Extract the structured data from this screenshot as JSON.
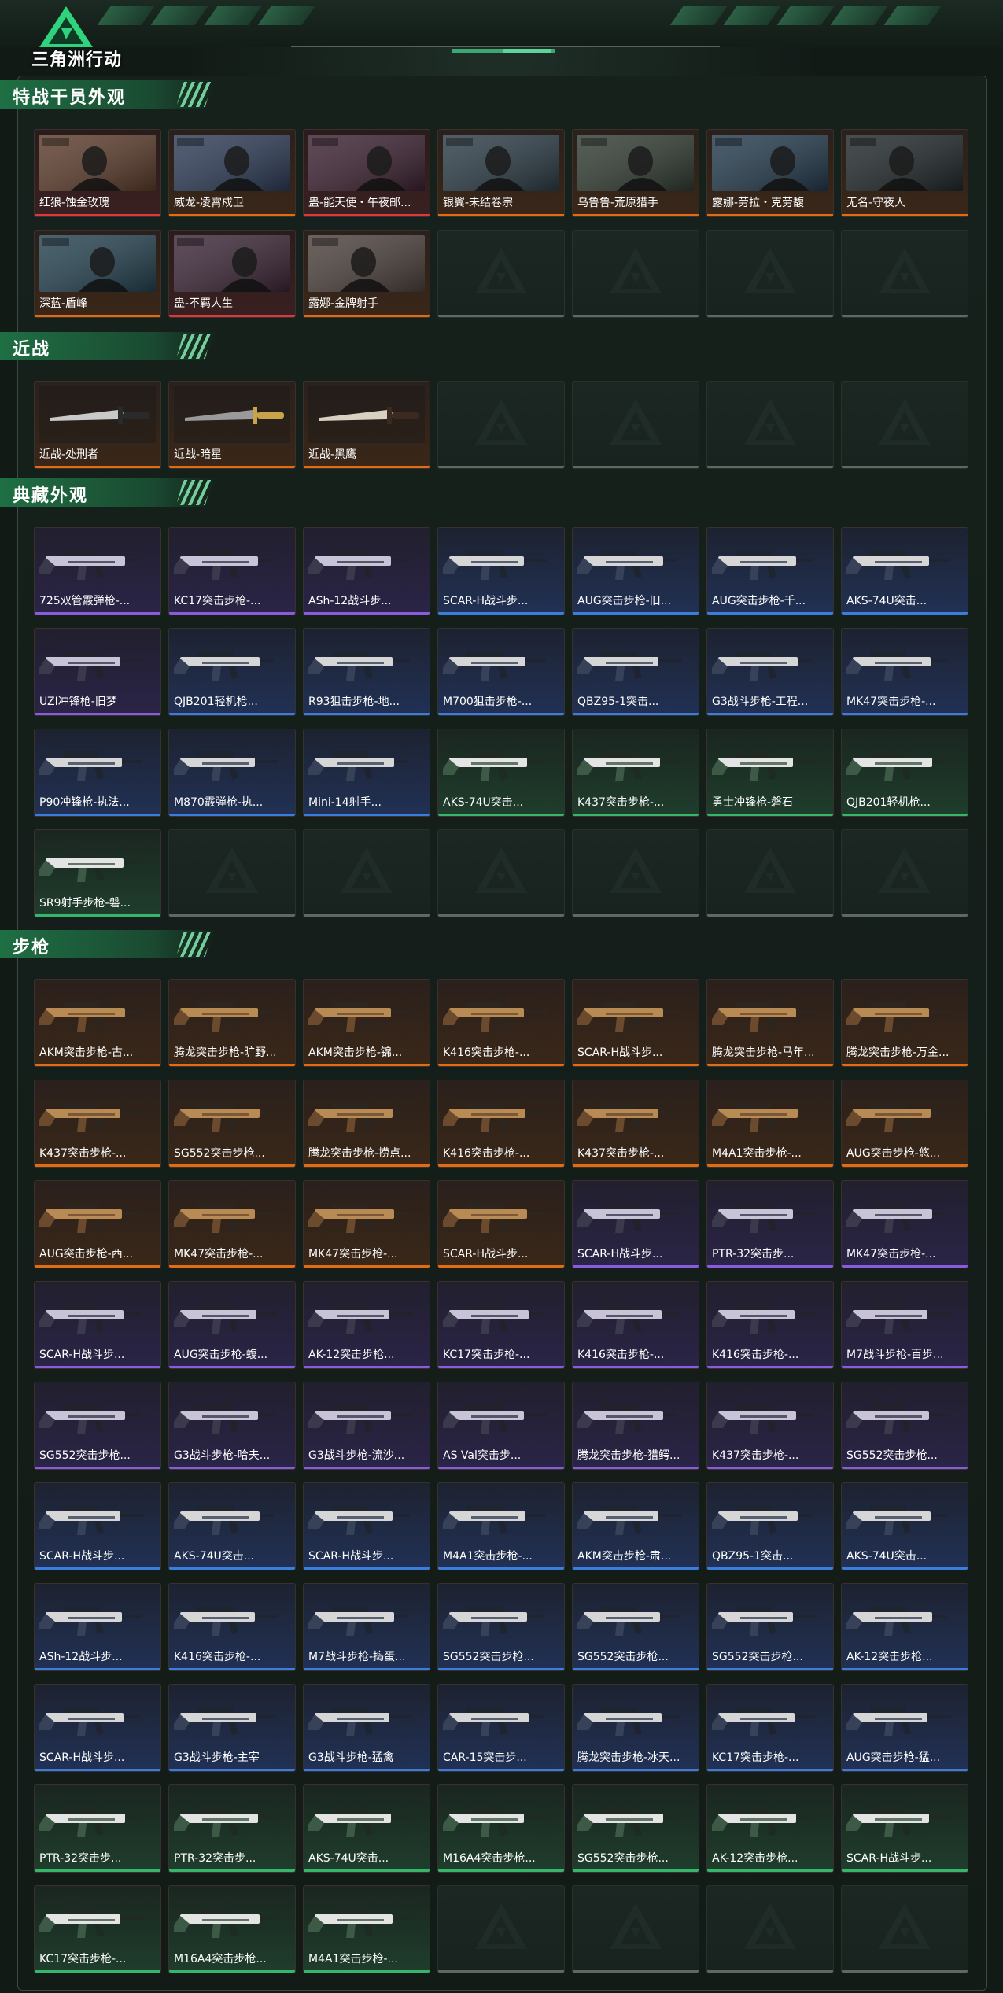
{
  "header": {
    "game_title": "三角洲行动",
    "logo_icon": "delta-logo-icon"
  },
  "colors": {
    "accent_green": "#36b66a",
    "rarity_orange": "#e06d16",
    "rarity_purple": "#8a5bdc",
    "rarity_blue": "#3b7ddc",
    "rarity_green": "#36b66a",
    "rarity_red": "#d93b3b"
  },
  "sections": [
    {
      "title": "特战干员外观",
      "kind": "operator",
      "items": [
        {
          "name": "红狼-蚀金玫瑰",
          "rarity": "red",
          "tag": "蚀金玫瑰"
        },
        {
          "name": "威龙-凌霄戍卫",
          "rarity": "orange",
          "tag": "凌霄戍卫"
        },
        {
          "name": "蛊-能天使・午夜邮差",
          "display": "蛊-能天使・午夜邮...",
          "rarity": "red",
          "tag": "午夜邮差"
        },
        {
          "name": "银翼-未结卷宗",
          "rarity": "orange",
          "tag": "未结卷宗"
        },
        {
          "name": "乌鲁鲁-荒原猎手",
          "rarity": "orange",
          "tag": ""
        },
        {
          "name": "露娜-劳拉・克劳馥",
          "rarity": "orange",
          "tag": "劳拉"
        },
        {
          "name": "无名-守夜人",
          "rarity": "orange",
          "tag": "守夜人"
        },
        {
          "name": "深蓝-盾峰",
          "rarity": "orange",
          "tag": "盾峰"
        },
        {
          "name": "蛊-不羁人生",
          "rarity": "red",
          "tag": "不羁人生"
        },
        {
          "name": "露娜-金牌射手",
          "rarity": "orange",
          "tag": ""
        }
      ],
      "slots": 14
    },
    {
      "title": "近战",
      "kind": "melee",
      "items": [
        {
          "name": "近战-处刑者",
          "rarity": "orange"
        },
        {
          "name": "近战-暗星",
          "rarity": "orange"
        },
        {
          "name": "近战-黑鹰",
          "rarity": "orange"
        }
      ],
      "slots": 7
    },
    {
      "title": "典藏外观",
      "kind": "weapon",
      "items": [
        {
          "name": "725双管霰弹枪-...",
          "rarity": "purple"
        },
        {
          "name": "KC17突击步枪-...",
          "rarity": "purple"
        },
        {
          "name": "ASh-12战斗步...",
          "rarity": "purple"
        },
        {
          "name": "SCAR-H战斗步...",
          "rarity": "blue"
        },
        {
          "name": "AUG突击步枪-旧...",
          "rarity": "blue"
        },
        {
          "name": "AUG突击步枪-千...",
          "rarity": "blue"
        },
        {
          "name": "AKS-74U突击...",
          "rarity": "blue"
        },
        {
          "name": "UZI冲锋枪-旧梦",
          "rarity": "purple"
        },
        {
          "name": "QJB201轻机枪...",
          "rarity": "blue"
        },
        {
          "name": "R93狙击步枪-地...",
          "rarity": "blue"
        },
        {
          "name": "M700狙击步枪-...",
          "rarity": "blue"
        },
        {
          "name": "QBZ95-1突击...",
          "rarity": "blue"
        },
        {
          "name": "G3战斗步枪-工程...",
          "rarity": "blue"
        },
        {
          "name": "MK47突击步枪-...",
          "rarity": "blue"
        },
        {
          "name": "P90冲锋枪-执法...",
          "rarity": "blue"
        },
        {
          "name": "M870霰弹枪-执...",
          "rarity": "blue"
        },
        {
          "name": "Mini-14射手...",
          "rarity": "blue"
        },
        {
          "name": "AKS-74U突击...",
          "rarity": "green"
        },
        {
          "name": "K437突击步枪-...",
          "rarity": "green"
        },
        {
          "name": "勇士冲锋枪-磐石",
          "rarity": "green"
        },
        {
          "name": "QJB201轻机枪...",
          "rarity": "green"
        },
        {
          "name": "SR9射手步枪-磐...",
          "rarity": "green"
        }
      ],
      "slots": 28
    },
    {
      "title": "步枪",
      "kind": "weapon",
      "items": [
        {
          "name": "AKM突击步枪-古...",
          "rarity": "orange"
        },
        {
          "name": "腾龙突击步枪-旷野...",
          "rarity": "orange"
        },
        {
          "name": "AKM突击步枪-锦...",
          "rarity": "orange"
        },
        {
          "name": "K416突击步枪-...",
          "rarity": "orange"
        },
        {
          "name": "SCAR-H战斗步...",
          "rarity": "orange"
        },
        {
          "name": "腾龙突击步枪-马年...",
          "rarity": "orange"
        },
        {
          "name": "腾龙突击步枪-万金...",
          "rarity": "orange"
        },
        {
          "name": "K437突击步枪-...",
          "rarity": "orange"
        },
        {
          "name": "SG552突击步枪...",
          "rarity": "orange"
        },
        {
          "name": "腾龙突击步枪-捞点...",
          "rarity": "orange"
        },
        {
          "name": "K416突击步枪-...",
          "rarity": "orange"
        },
        {
          "name": "K437突击步枪-...",
          "rarity": "orange"
        },
        {
          "name": "M4A1突击步枪-...",
          "rarity": "orange"
        },
        {
          "name": "AUG突击步枪-悠...",
          "rarity": "orange"
        },
        {
          "name": "AUG突击步枪-西...",
          "rarity": "orange"
        },
        {
          "name": "MK47突击步枪-...",
          "rarity": "orange"
        },
        {
          "name": "MK47突击步枪-...",
          "rarity": "orange"
        },
        {
          "name": "SCAR-H战斗步...",
          "rarity": "orange"
        },
        {
          "name": "SCAR-H战斗步...",
          "rarity": "purple"
        },
        {
          "name": "PTR-32突击步...",
          "rarity": "purple"
        },
        {
          "name": "MK47突击步枪-...",
          "rarity": "purple"
        },
        {
          "name": "SCAR-H战斗步...",
          "rarity": "purple"
        },
        {
          "name": "AUG突击步枪-蝮...",
          "rarity": "purple"
        },
        {
          "name": "AK-12突击步枪...",
          "rarity": "purple"
        },
        {
          "name": "KC17突击步枪-...",
          "rarity": "purple"
        },
        {
          "name": "K416突击步枪-...",
          "rarity": "purple"
        },
        {
          "name": "K416突击步枪-...",
          "rarity": "purple"
        },
        {
          "name": "M7战斗步枪-百步...",
          "rarity": "purple"
        },
        {
          "name": "SG552突击步枪...",
          "rarity": "purple"
        },
        {
          "name": "G3战斗步枪-哈夫...",
          "rarity": "purple"
        },
        {
          "name": "G3战斗步枪-流沙...",
          "rarity": "purple"
        },
        {
          "name": "AS Val突击步...",
          "rarity": "purple"
        },
        {
          "name": "腾龙突击步枪-猎鳄...",
          "rarity": "purple"
        },
        {
          "name": "K437突击步枪-...",
          "rarity": "purple"
        },
        {
          "name": "SG552突击步枪...",
          "rarity": "purple"
        },
        {
          "name": "SCAR-H战斗步...",
          "rarity": "blue"
        },
        {
          "name": "AKS-74U突击...",
          "rarity": "blue"
        },
        {
          "name": "SCAR-H战斗步...",
          "rarity": "blue"
        },
        {
          "name": "M4A1突击步枪-...",
          "rarity": "blue"
        },
        {
          "name": "AKM突击步枪-肃...",
          "rarity": "blue"
        },
        {
          "name": "QBZ95-1突击...",
          "rarity": "blue"
        },
        {
          "name": "AKS-74U突击...",
          "rarity": "blue"
        },
        {
          "name": "ASh-12战斗步...",
          "rarity": "blue"
        },
        {
          "name": "K416突击步枪-...",
          "rarity": "blue"
        },
        {
          "name": "M7战斗步枪-捣蛋...",
          "rarity": "blue"
        },
        {
          "name": "SG552突击步枪...",
          "rarity": "blue"
        },
        {
          "name": "SG552突击步枪...",
          "rarity": "blue"
        },
        {
          "name": "SG552突击步枪...",
          "rarity": "blue"
        },
        {
          "name": "AK-12突击步枪...",
          "rarity": "blue"
        },
        {
          "name": "SCAR-H战斗步...",
          "rarity": "blue"
        },
        {
          "name": "G3战斗步枪-主宰",
          "rarity": "blue"
        },
        {
          "name": "G3战斗步枪-猛禽",
          "rarity": "blue"
        },
        {
          "name": "CAR-15突击步...",
          "rarity": "blue"
        },
        {
          "name": "腾龙突击步枪-冰天...",
          "rarity": "blue"
        },
        {
          "name": "KC17突击步枪-...",
          "rarity": "blue"
        },
        {
          "name": "AUG突击步枪-猛...",
          "rarity": "blue"
        },
        {
          "name": "PTR-32突击步...",
          "rarity": "green"
        },
        {
          "name": "PTR-32突击步...",
          "rarity": "green"
        },
        {
          "name": "AKS-74U突击...",
          "rarity": "green"
        },
        {
          "name": "M16A4突击步枪...",
          "rarity": "green"
        },
        {
          "name": "SG552突击步枪...",
          "rarity": "green"
        },
        {
          "name": "AK-12突击步枪...",
          "rarity": "green"
        },
        {
          "name": "SCAR-H战斗步...",
          "rarity": "green"
        },
        {
          "name": "KC17突击步枪-...",
          "rarity": "green"
        },
        {
          "name": "M16A4突击步枪...",
          "rarity": "green"
        },
        {
          "name": "M4A1突击步枪-...",
          "rarity": "green"
        }
      ],
      "slots": 70
    }
  ]
}
